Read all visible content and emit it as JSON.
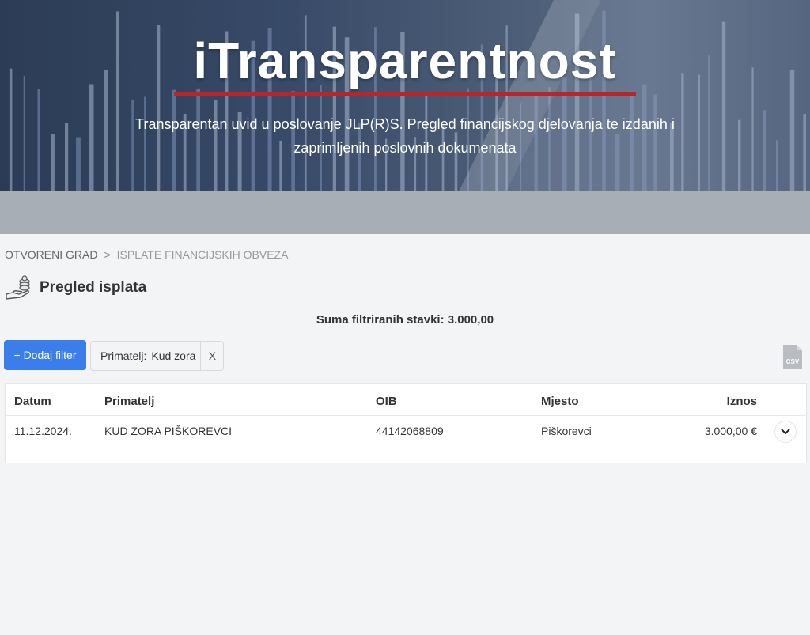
{
  "hero": {
    "title": "iTransparentnost",
    "subtitle": "Transparentan uvid u poslovanje JLP(R)S. Pregled financijskog djelovanja te izdanih i zaprimljenih poslovnih dokumenata",
    "accent_color": "#b8262a"
  },
  "breadcrumb": {
    "items": [
      "OTVORENI GRAD",
      "ISPLATE FINANCIJSKIH OBVEZA"
    ],
    "separator": ">"
  },
  "page": {
    "title": "Pregled isplata",
    "icon": "hand-coins-icon",
    "sum_label": "Suma filtriranih stavki: 3.000,00"
  },
  "toolbar": {
    "add_filter_label": "+ Dodaj filter",
    "add_filter_color": "#3b7dea",
    "filter_chip": {
      "label": "Primatelj:",
      "value": "Kud zora",
      "remove": "X"
    },
    "export_icon": "csv-file-icon",
    "export_label": "CSV"
  },
  "table": {
    "columns": [
      "Datum",
      "Primatelj",
      "OIB",
      "Mjesto",
      "Iznos"
    ],
    "rows": [
      [
        "11.12.2024.",
        "KUD ZORA PIŠKOREVCI",
        "44142068809",
        "Piškorevci",
        "3.000,00 €"
      ]
    ],
    "row_action_icon": "chevron-down-icon"
  }
}
